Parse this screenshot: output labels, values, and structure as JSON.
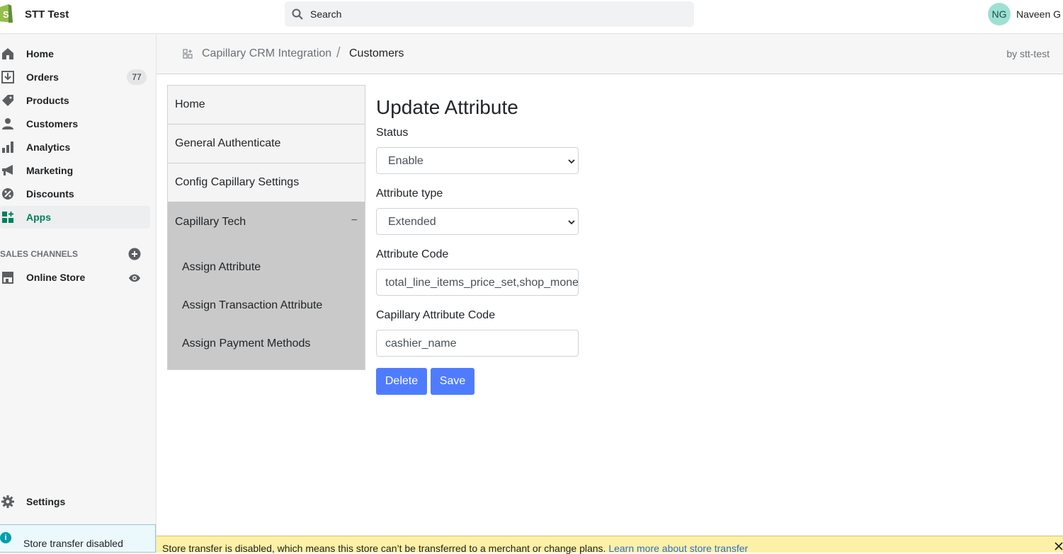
{
  "topbar": {
    "store_name": "STT Test",
    "search_placeholder": "Search",
    "avatar_initials": "NG",
    "user_name": "Naveen G"
  },
  "sidebar": {
    "items": [
      {
        "label": "Home",
        "icon": "home-icon"
      },
      {
        "label": "Orders",
        "icon": "orders-icon",
        "badge": "77"
      },
      {
        "label": "Products",
        "icon": "tag-icon"
      },
      {
        "label": "Customers",
        "icon": "person-icon"
      },
      {
        "label": "Analytics",
        "icon": "bar-chart-icon"
      },
      {
        "label": "Marketing",
        "icon": "megaphone-icon"
      },
      {
        "label": "Discounts",
        "icon": "discount-icon"
      },
      {
        "label": "Apps",
        "icon": "apps-icon",
        "active": true
      }
    ],
    "sales_channels_label": "SALES CHANNELS",
    "online_store_label": "Online Store",
    "settings_label": "Settings",
    "transfer_notice": "Store transfer disabled"
  },
  "header": {
    "app_name": "Capillary CRM Integration",
    "separator": "/",
    "page": "Customers",
    "by": "by stt-test"
  },
  "app_menu": {
    "items": [
      "Home",
      "General Authenticate",
      "Config Capillary Settings"
    ],
    "expanded": {
      "label": "Capillary Tech",
      "toggle": "−",
      "children": [
        "Assign Attribute",
        "Assign Transaction Attribute",
        "Assign Payment Methods"
      ]
    }
  },
  "form": {
    "title": "Update Attribute",
    "status_label": "Status",
    "status_value": "Enable",
    "type_label": "Attribute type",
    "type_value": "Extended",
    "code_label": "Attribute Code",
    "code_value": "total_line_items_price_set,shop_money,amount",
    "cap_code_label": "Capillary Attribute Code",
    "cap_code_value": "cashier_name",
    "delete_label": "Delete",
    "save_label": "Save"
  },
  "banner": {
    "message": "Store transfer is disabled, which means this store can’t be transferred to a merchant or change plans. ",
    "link": "Learn more about store transfer"
  },
  "colors": {
    "accent_green": "#007f5f",
    "button_blue": "#4f7cff",
    "banner_yellow": "#fcf1a6"
  }
}
